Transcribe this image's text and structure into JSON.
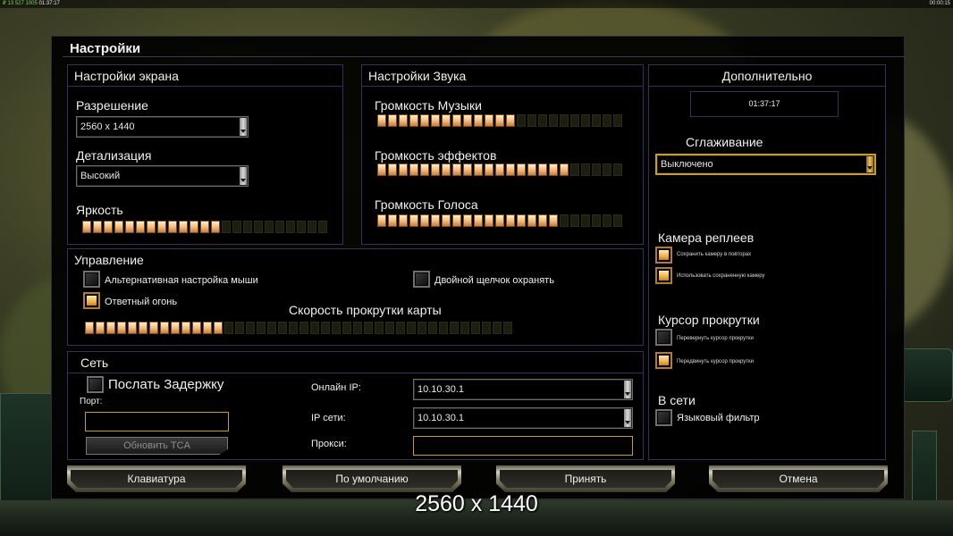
{
  "hud": {
    "top_left_resources": "₽ 13 527 1005",
    "top_left_clock": "01:37:17",
    "top_right_clock": "00:00:15"
  },
  "bottom_caption": "2560 x 1440",
  "dialog": {
    "title": "Настройки",
    "screen": {
      "header": "Настройки экрана",
      "resolution_label": "Разрешение",
      "resolution_value": "2560 x 1440",
      "detail_label": "Детализация",
      "detail_value": "Высокий",
      "brightness_label": "Яркость",
      "brightness_level": 0.55
    },
    "sound": {
      "header": "Настройки Звука",
      "music_label": "Громкость Музыки",
      "music_level": 0.55,
      "effects_label": "Громкость эффектов",
      "effects_level": 0.8,
      "voice_label": "Громкость Голоса",
      "voice_level": 0.72
    },
    "extra": {
      "header": "Дополнительно",
      "clock": "01:37:17",
      "aa_label": "Сглаживание",
      "aa_value": "Выключено",
      "replay_cam_label": "Камера реплеев",
      "replay_cam_save": "Сохранить камеру в повторах",
      "replay_cam_use": "Использовать сохраненную камеру",
      "scroll_cursor_label": "Курсор прокрутки",
      "scroll_cursor_invert": "Перевернуть курсор прокрутки",
      "scroll_cursor_move": "Передвинуть курсор прокрутки",
      "online_label": "В сети",
      "lang_filter": "Языковый фильтр"
    },
    "controls": {
      "header": "Управление",
      "alt_mouse": "Альтернативная настройка мыши",
      "double_click": "Двойной щелчок охранять",
      "return_fire": "Ответный огонь",
      "scroll_speed_label": "Скорость прокрутки карты",
      "scroll_speed_level": 0.32
    },
    "network": {
      "header": "Сеть",
      "send_delay": "Послать Задержку",
      "port_label": "Порт:",
      "port_value": "",
      "update_tca": "Обновить TCA",
      "online_ip_label": "Онлайн IP:",
      "online_ip_value": "10.10.30.1",
      "lan_ip_label": "IP сети:",
      "lan_ip_value": "10.10.30.1",
      "proxy_label": "Прокси:",
      "proxy_value": ""
    },
    "buttons": {
      "keyboard": "Клавиатура",
      "defaults": "По умолчанию",
      "accept": "Принять",
      "cancel": "Отмена"
    }
  },
  "colors": {
    "slider_on": "#f1b87c",
    "accent_gold": "#c99a35",
    "panel_border": "#33335a"
  }
}
